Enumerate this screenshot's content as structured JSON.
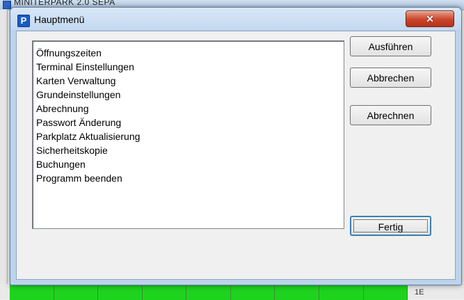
{
  "background_app": {
    "title": "MINITERPARK 2.0 SEPA",
    "right_label": "1E"
  },
  "dialog": {
    "title": "Hauptmenü",
    "app_icon_letter": "P",
    "close_icon_glyph": "✕"
  },
  "menu_list": {
    "items": [
      "Öffnungszeiten",
      "Terminal Einstellungen",
      "Karten Verwaltung",
      "Grundeinstellungen",
      "Abrechnung",
      "Passwort Änderung",
      "Parkplatz Aktualisierung",
      "Sicherheitskopie",
      "Buchungen",
      "Programm beenden"
    ]
  },
  "buttons": {
    "ausfuehren": "Ausführen",
    "abbrechen": "Abbrechen",
    "abrechnen": "Abrechnen",
    "fertig": "Fertig"
  },
  "colors": {
    "status_green": "#1ed31e",
    "close_red": "#c9452b",
    "title_blue": "#c3d8ef"
  }
}
